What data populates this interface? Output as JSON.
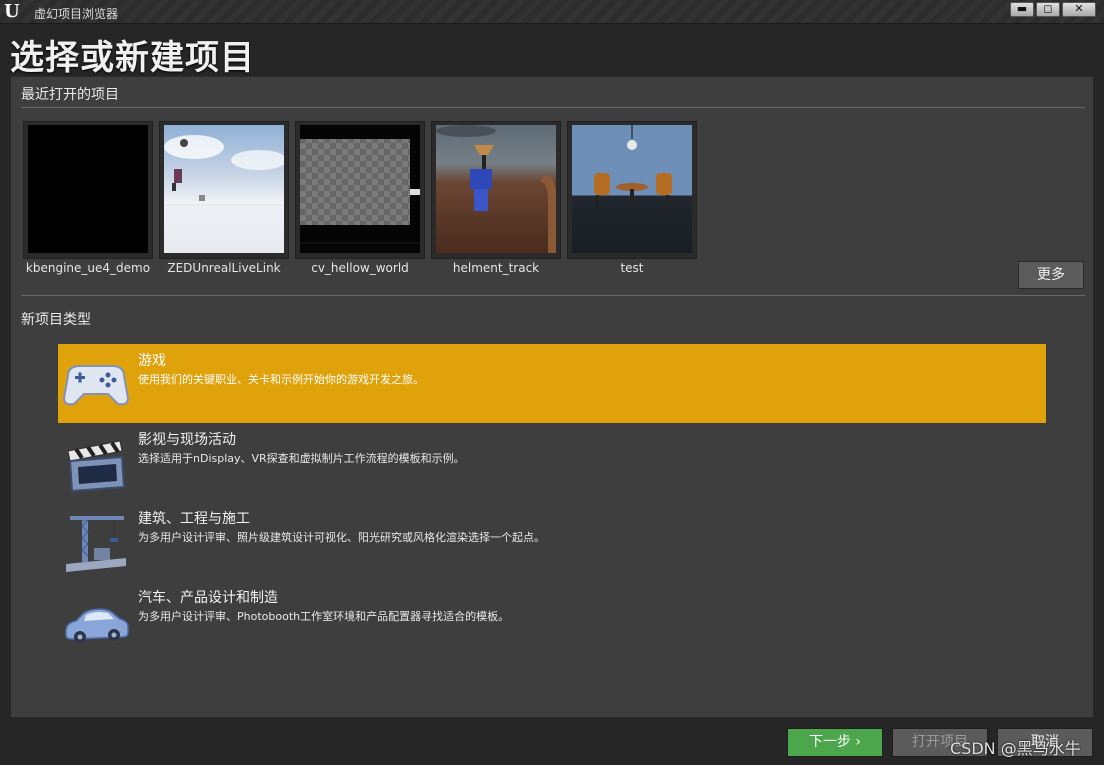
{
  "window": {
    "title": "虚幻项目浏览器",
    "logo": "U",
    "minimize": "▬",
    "maximize": "◻",
    "close": "✕"
  },
  "page_title": "选择或新建项目",
  "recent": {
    "label": "最近打开的项目",
    "projects": [
      {
        "name": "kbengine_ue4_demo"
      },
      {
        "name": "ZEDUnrealLiveLink"
      },
      {
        "name": "cv_hellow_world"
      },
      {
        "name": "helment_track"
      },
      {
        "name": "test"
      }
    ],
    "more_label": "更多"
  },
  "new_project": {
    "label": "新项目类型",
    "types": [
      {
        "title": "游戏",
        "desc": "使用我们的关键职业、关卡和示例开始你的游戏开发之旅。",
        "icon": "gamepad-icon"
      },
      {
        "title": "影视与现场活动",
        "desc": "选择适用于nDisplay、VR探查和虚拟制片工作流程的模板和示例。",
        "icon": "clapperboard-icon"
      },
      {
        "title": "建筑、工程与施工",
        "desc": "为多用户设计评审、照片级建筑设计可视化、阳光研究或风格化渲染选择一个起点。",
        "icon": "crane-icon"
      },
      {
        "title": "汽车、产品设计和制造",
        "desc": "为多用户设计评审、Photobooth工作室环境和产品配置器寻找适合的模板。",
        "icon": "car-icon"
      }
    ]
  },
  "footer": {
    "next": "下一步 ›",
    "open": "打开项目",
    "cancel": "取消"
  },
  "watermark": "CSDN @黑马水牛",
  "colors": {
    "selected": "#e0a20a",
    "next_button": "#4ca64c",
    "panel": "#3e3e3e"
  }
}
